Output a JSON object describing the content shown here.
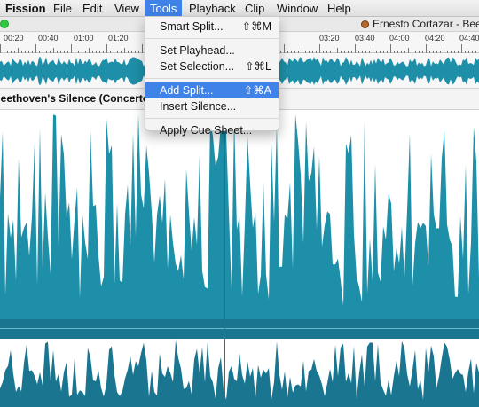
{
  "menubar": {
    "app_name": "Fission",
    "items": [
      "File",
      "Edit",
      "View",
      "Tools",
      "Playback",
      "Clip",
      "Window",
      "Help"
    ],
    "active_item": "Tools"
  },
  "window": {
    "title": "Ernesto Cortazar - Beethoven's Silence (Concerto)"
  },
  "timeline": {
    "ticks": [
      "00:20",
      "00:40",
      "01:00",
      "01:20",
      "03:20",
      "03:40",
      "04:00",
      "04:20",
      "04:40"
    ]
  },
  "track": {
    "name": "Beethoven's Silence (Concerto)"
  },
  "tools_menu": {
    "smart_split": {
      "label": "Smart Split...",
      "shortcut": "⇧⌘M"
    },
    "set_playhead": {
      "label": "Set Playhead..."
    },
    "set_selection": {
      "label": "Set Selection...",
      "shortcut": "⇧⌘L"
    },
    "add_split": {
      "label": "Add Split...",
      "shortcut": "⇧⌘A",
      "highlighted": true
    },
    "insert_silence": {
      "label": "Insert Silence..."
    },
    "apply_cue_sheet": {
      "label": "Apply Cue Sheet..."
    }
  },
  "colors": {
    "waveform": "#1e8fa8",
    "waveform_dark": "#1a7590",
    "highlight": "#3f82e8",
    "playhead": "#c0392b"
  }
}
